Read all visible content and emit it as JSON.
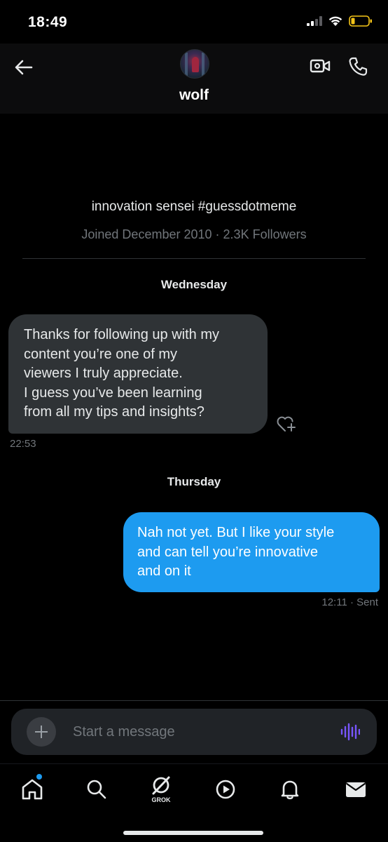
{
  "status_bar": {
    "time": "18:49",
    "icons": [
      "cellular-signal-icon",
      "wifi-icon",
      "battery-low-icon"
    ],
    "battery_color": "#f5c518"
  },
  "header": {
    "username": "wolf",
    "icons": [
      "back-arrow-icon",
      "avatar",
      "video-call-icon",
      "phone-call-icon"
    ]
  },
  "profile": {
    "bio": "innovation sensei #guessdotmeme",
    "joined": "Joined December 2010",
    "separator": "·",
    "followers": "2.3K Followers"
  },
  "conversation": {
    "day1": "Wednesday",
    "incoming": {
      "lines": [
        "Thanks for following up with my",
        "content you’re one of my",
        "viewers I truly appreciate.",
        "I guess you’ve been learning",
        "from all my tips and insights?"
      ],
      "timestamp": "22:53"
    },
    "day2": "Thursday",
    "outgoing": {
      "lines": [
        "Nah not yet. But I like your style",
        "and can tell you’re innovative",
        "and on it"
      ],
      "timestamp": "12:11",
      "status": "· Sent"
    }
  },
  "composer": {
    "placeholder": "Start a message"
  },
  "bottom_nav": {
    "items": [
      {
        "icon": "home-icon",
        "has_notification_dot": true
      },
      {
        "icon": "search-icon"
      },
      {
        "icon": "grok-icon",
        "label": "GROK"
      },
      {
        "icon": "video-play-icon"
      },
      {
        "icon": "bell-icon"
      },
      {
        "icon": "mail-icon"
      }
    ]
  },
  "colors": {
    "background": "#000000",
    "incoming_bubble": "#2f3336",
    "outgoing_bubble": "#1d9bf0",
    "muted_text": "#71767b",
    "voice_accent": "#7856ff",
    "notification_dot": "#1d9bf0"
  }
}
